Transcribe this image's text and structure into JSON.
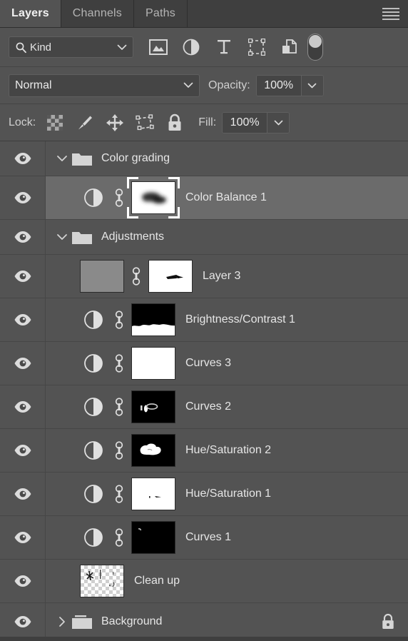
{
  "panel": {
    "tabs": [
      {
        "label": "Layers",
        "active": true
      },
      {
        "label": "Channels",
        "active": false
      },
      {
        "label": "Paths",
        "active": false
      }
    ],
    "menu_icon": "hamburger-menu-icon"
  },
  "filter": {
    "kind_label": "Kind",
    "search_icon": "magnifier-icon",
    "dropdown_icon": "chevron-down-icon",
    "icons": [
      "filter-pixel-layers-icon",
      "filter-adjustment-layers-icon",
      "filter-type-layers-icon",
      "filter-shape-layers-icon",
      "filter-smart-object-layers-icon"
    ],
    "toggle_name": "filter-enable-toggle"
  },
  "blend": {
    "mode": "Normal",
    "opacity_label": "Opacity:",
    "opacity_value": "100%",
    "fill_label": "Fill:",
    "fill_value": "100%"
  },
  "lock": {
    "label": "Lock:",
    "icons": [
      "lock-transparent-pixels-icon",
      "lock-image-pixels-icon",
      "lock-position-icon",
      "lock-artboard-nesting-icon",
      "lock-all-icon"
    ]
  },
  "colors": {
    "panel_bg": "#535353",
    "tab_inactive_bg": "#3f3f3f",
    "selected_row_bg": "#6b6b6b",
    "text": "#e6e6e6",
    "field_bg": "#454545"
  },
  "layers": [
    {
      "name": "Color grading",
      "type": "group",
      "expanded": true,
      "visible": true,
      "selected": false,
      "locked": false
    },
    {
      "name": "Color Balance 1",
      "type": "adjustment",
      "indent": 1,
      "visible": true,
      "selected": true,
      "has_adjustment_icon": true,
      "linked": true,
      "mask": "blurred-dark-blob",
      "mask_selected": true,
      "locked": false
    },
    {
      "name": "Adjustments",
      "type": "group",
      "expanded": true,
      "visible": true,
      "selected": false,
      "locked": false
    },
    {
      "name": "Layer 3",
      "type": "pixel",
      "indent": 1,
      "visible": true,
      "selected": false,
      "has_pixel_thumb": true,
      "linked": true,
      "mask": "white-with-dark-stroke",
      "mask_selected": false,
      "locked": false
    },
    {
      "name": "Brightness/Contrast 1",
      "type": "adjustment",
      "indent": 1,
      "visible": true,
      "selected": false,
      "has_adjustment_icon": true,
      "linked": true,
      "mask": "black-top-white-bottom",
      "mask_selected": false,
      "locked": false
    },
    {
      "name": "Curves 3",
      "type": "adjustment",
      "indent": 1,
      "visible": true,
      "selected": false,
      "has_adjustment_icon": true,
      "linked": true,
      "mask": "all-white",
      "mask_selected": false,
      "locked": false
    },
    {
      "name": "Curves 2",
      "type": "adjustment",
      "indent": 1,
      "visible": true,
      "selected": false,
      "has_adjustment_icon": true,
      "linked": true,
      "mask": "black-with-small-white-marks",
      "mask_selected": false,
      "locked": false
    },
    {
      "name": "Hue/Saturation 2",
      "type": "adjustment",
      "indent": 1,
      "visible": true,
      "selected": false,
      "has_adjustment_icon": true,
      "linked": true,
      "mask": "black-with-white-blob",
      "mask_selected": false,
      "locked": false
    },
    {
      "name": "Hue/Saturation 1",
      "type": "adjustment",
      "indent": 1,
      "visible": true,
      "selected": false,
      "has_adjustment_icon": true,
      "linked": true,
      "mask": "white-with-small-dark-marks",
      "mask_selected": false,
      "locked": false
    },
    {
      "name": "Curves 1",
      "type": "adjustment",
      "indent": 1,
      "visible": true,
      "selected": false,
      "has_adjustment_icon": true,
      "linked": true,
      "mask": "black-with-tiny-white-mark",
      "mask_selected": false,
      "locked": false
    },
    {
      "name": "Clean up",
      "type": "pixel",
      "indent": 1,
      "visible": true,
      "selected": false,
      "has_transparent_thumb": true,
      "linked": false,
      "locked": false
    },
    {
      "name": "Background",
      "type": "group",
      "expanded": false,
      "visible": true,
      "selected": false,
      "locked": true,
      "lock_icon": "lock-closed-icon"
    }
  ]
}
